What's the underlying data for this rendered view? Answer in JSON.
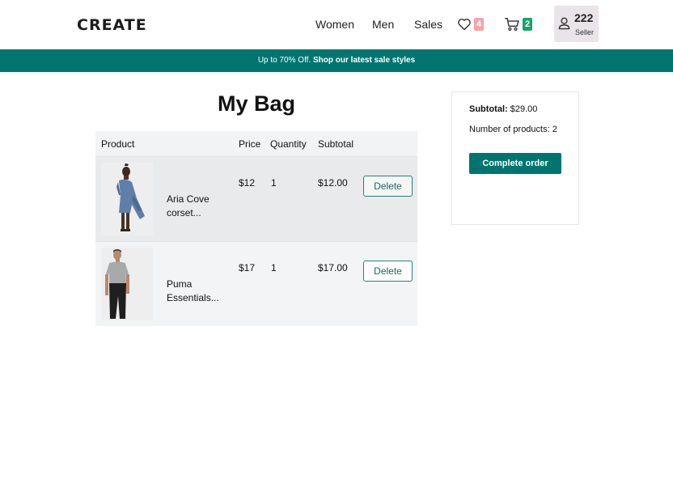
{
  "header": {
    "logo": "CREATE",
    "nav": {
      "women": "Women",
      "men": "Men",
      "sales": "Sales"
    },
    "wishlist_count": "4",
    "cart_count": "2",
    "user": {
      "count": "222",
      "role": "Seller"
    }
  },
  "banner": {
    "text": "Up to 70% Off. ",
    "link": "Shop our latest sale styles"
  },
  "bag": {
    "title": "My Bag",
    "columns": {
      "product": "Product",
      "price": "Price",
      "quantity": "Quantity",
      "subtotal": "Subtotal"
    },
    "items": [
      {
        "name": "Aria Cove corset...",
        "price": "$12",
        "quantity": "1",
        "subtotal": "$12.00",
        "delete_label": "Delete"
      },
      {
        "name": "Puma Essentials...",
        "price": "$17",
        "quantity": "1",
        "subtotal": "$17.00",
        "delete_label": "Delete"
      }
    ]
  },
  "summary": {
    "subtotal_label": "Subtotal:",
    "subtotal_value": " $29.00",
    "count_label": "Number of products: ",
    "count_value": "2",
    "complete_label": "Complete order"
  },
  "colors": {
    "brand": "#007570",
    "wishlist_badge": "#f1a6a6",
    "cart_badge": "#1aa36a"
  }
}
